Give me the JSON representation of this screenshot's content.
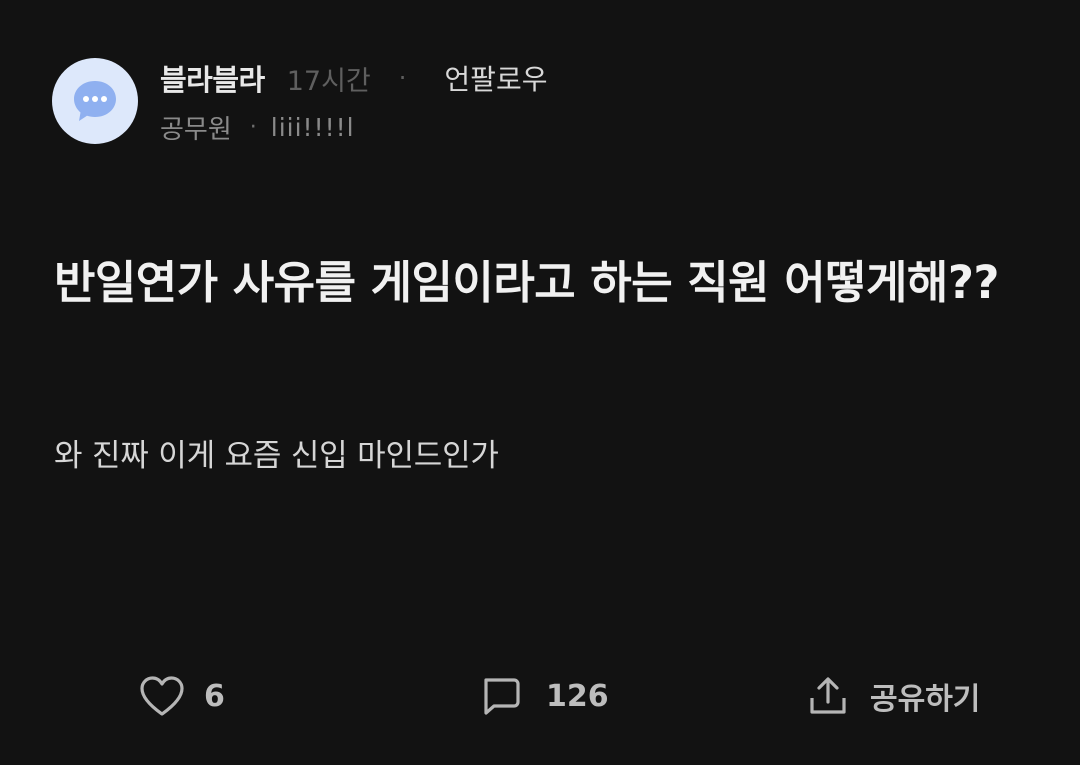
{
  "post": {
    "author": "블라블라",
    "time": "17시간",
    "separator": "·",
    "follow_label": "언팔로우",
    "company": "공무원",
    "nickname": "liii!!!!l",
    "title": "반일연가 사유를 게임이라고 하는 직원 어떻게해??",
    "body": "와 진짜 이게 요즘 신입 마인드인가"
  },
  "actions": {
    "likes": "6",
    "comments": "126",
    "share_label": "공유하기"
  },
  "icons": {
    "avatar": "speech-bubble-icon",
    "like": "heart-outline-icon",
    "comment": "comment-bubble-icon",
    "share": "share-upload-icon"
  },
  "colors": {
    "background": "#121212",
    "avatar_bg": "#dde8fb",
    "avatar_bubble": "#8fb0f0"
  }
}
